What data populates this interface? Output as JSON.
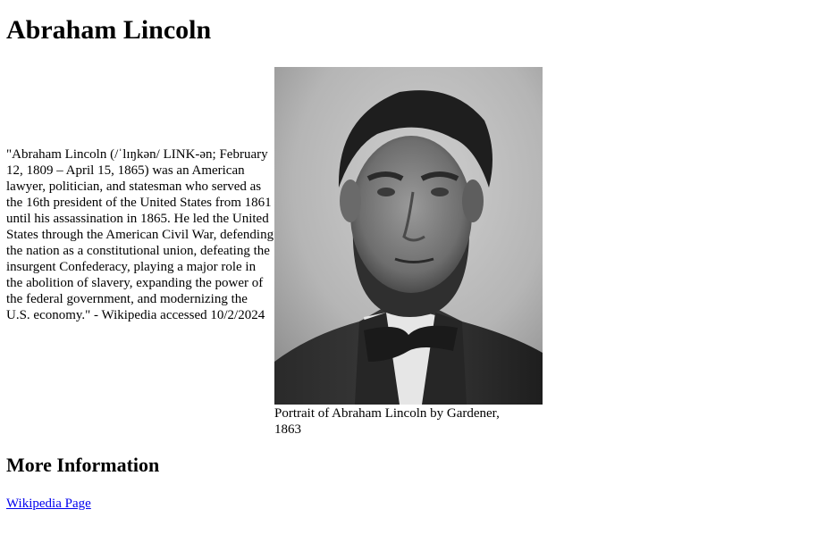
{
  "page_title": "Abraham Lincoln",
  "quote": "\"Abraham Lincoln (/ˈlɪŋkən/ LINK-ən; February 12, 1809 – April 15, 1865) was an American lawyer, politician, and statesman who served as the 16th president of the United States from 1861 until his assassination in 1865. He led the United States through the American Civil War, defending the nation as a constitutional union, defeating the insurgent Confederacy, playing a major role in the abolition of slavery, expanding the power of the federal government, and modernizing the U.S. economy.\" - Wikipedia accessed 10/2/2024",
  "portrait": {
    "caption": "Portrait of Abraham Lincoln by Gardener, 1863"
  },
  "more_info": {
    "heading": "More Information",
    "link_label": "Wikipedia Page"
  },
  "colors": {
    "link": "#0000ee",
    "text": "#000000",
    "background": "#ffffff"
  }
}
